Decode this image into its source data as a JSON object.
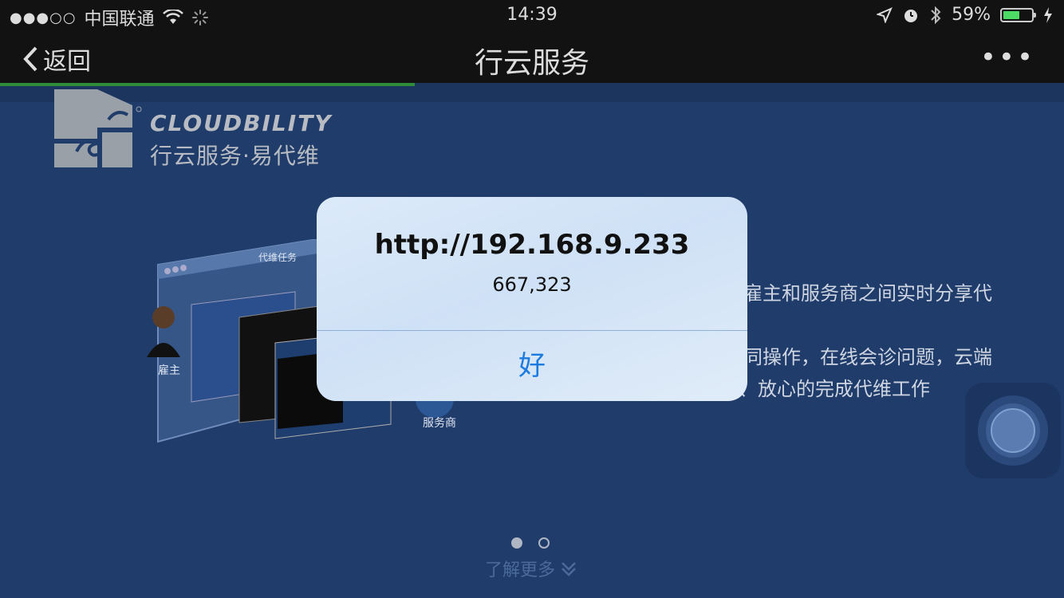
{
  "status_bar": {
    "signal_dots": "●●●○○",
    "carrier": "中国联通",
    "time": "14:39",
    "battery_percent": "59%",
    "battery_level": 0.59
  },
  "nav": {
    "back_label": "返回",
    "title": "行云服务",
    "more_label": "•••"
  },
  "page_load_progress": 0.39,
  "logo": {
    "brand_en": "CLOUDBILITY",
    "brand_cn": "行云服务·易代维"
  },
  "illustration": {
    "window_title": "代维任务",
    "left_label": "雇主",
    "right_label": "服务商"
  },
  "description": {
    "line1": "雇主和服务商之间实时分享代",
    "line2": "同操作，在线会诊问题，云端",
    "line3": "、放心的完成代维工作"
  },
  "pager": {
    "total": 2,
    "current": 1
  },
  "learn_more": "了解更多",
  "alert": {
    "title": "http://192.168.9.233",
    "message": "667,323",
    "ok_label": "好"
  },
  "colors": {
    "background": "#1f3c6b",
    "alert_button": "#1a7ae0",
    "progress": "#2e8b3a"
  }
}
